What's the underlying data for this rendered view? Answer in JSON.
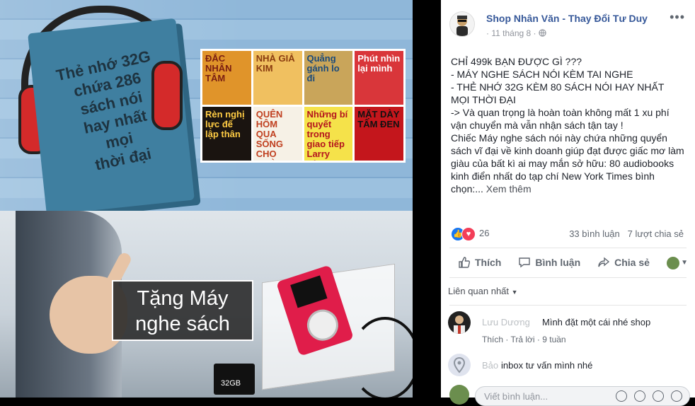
{
  "image_top": {
    "book_text": "Thẻ nhớ 32G\nchứa 286\nsách nói\nhay nhất\nmọi\nthời đại",
    "covers": [
      {
        "text": "ĐẮC NHÂN TÂM",
        "bg": "#e0942a",
        "fg": "#7a1e12"
      },
      {
        "text": "NHÀ GIẢ KIM",
        "bg": "#f0c060",
        "fg": "#8a3c10"
      },
      {
        "text": "Quẳng gánh lo đi",
        "bg": "#c9a55a",
        "fg": "#1a4a7a"
      },
      {
        "text": "Phút nhìn lại mình",
        "bg": "#d9363a",
        "fg": "#ffffff"
      },
      {
        "text": "Rèn nghị lực để lập thân",
        "bg": "#1a1410",
        "fg": "#ffcc44"
      },
      {
        "text": "QUÊN HÔM QUA SỐNG CHO NGÀY MAI",
        "bg": "#f6f1e6",
        "fg": "#c04020"
      },
      {
        "text": "Những bí quyết trong giao tiếp Larry King",
        "bg": "#f5e24a",
        "fg": "#b4141e"
      },
      {
        "text": "MẶT DÀY TÂM ĐEN",
        "bg": "#c4161c",
        "fg": "#111111"
      }
    ]
  },
  "image_bottom": {
    "gift_text": "Tặng Máy\nnghe sách",
    "sd_label": "32GB"
  },
  "post": {
    "page_name": "Shop Nhân Văn - Thay Đổi Tư Duy",
    "time": "11 tháng 8",
    "separator": "·",
    "body": "CHỈ 499k BẠN ĐƯỢC GÌ ???\n- MÁY NGHE SÁCH NÓI KÈM TAI NGHE\n- THẺ NHỚ 32G KÈM 80 SÁCH NÓI HAY NHẤT MỌI THỜI ĐẠI\n-> Và quan trọng là hoàn toàn không mất 1 xu phí vận chuyển mà vẫn nhận sách tận tay !\nChiếc Máy nghe sách nói này chứa những quyển sách vĩ đại về kinh doanh giúp đạt được giấc mơ làm giàu của bất kì ai may mắn sở hữu: 80 audiobooks kinh điển nhất do tạp chí New York Times bình chọn:...",
    "see_more": " Xem thêm",
    "reaction_count": "26",
    "comments_count": "33 bình luận",
    "shares_count": "7 lượt chia sẻ",
    "actions": {
      "like": "Thích",
      "comment": "Bình luận",
      "share": "Chia sẻ"
    },
    "filter_label": "Liên quan nhất",
    "comments": [
      {
        "name": "Lưu Dương",
        "text": "Mình đặt một cái nhé shop",
        "like": "Thích",
        "reply": "Trả lời",
        "age": "9 tuần"
      },
      {
        "name": "Bảo",
        "text": "inbox tư vấn mình nhé"
      }
    ],
    "input_placeholder": "Viết bình luận..."
  },
  "colors": {
    "link": "#365899",
    "like_blue": "#1877f2",
    "love_red": "#f33e58"
  }
}
